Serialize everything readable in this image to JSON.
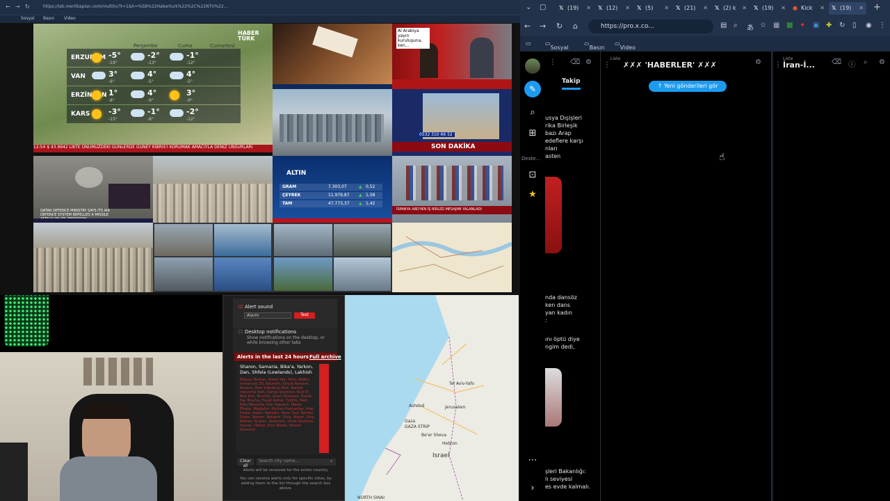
{
  "left_browser": {
    "url": "https://lab.meritkaplan.com/multitv/?t=1&h=%5B%22Haberturk%22%2C%22NTV%22...",
    "bookmarks": [
      "Sosyal",
      "Basın",
      "Video"
    ],
    "weather": {
      "brand": "HABER TÜRK",
      "days": [
        "Perşembe",
        "Cuma",
        "Cumartesi"
      ],
      "rows": [
        {
          "city": "ERZURUM",
          "t": [
            "-5°",
            "-2°",
            "-1°"
          ],
          "s": [
            "-19°",
            "-13°",
            "-12°"
          ]
        },
        {
          "city": "VAN",
          "t": [
            "3°",
            "4°",
            "4°"
          ],
          "s": [
            "-6°",
            "-5°",
            "-5°"
          ]
        },
        {
          "city": "ERZİNCAN",
          "t": [
            "1°",
            "4°",
            "3°"
          ],
          "s": [
            "-8°",
            "-9°",
            "-9°"
          ]
        },
        {
          "city": "KARS",
          "t": [
            "-3°",
            "-1°",
            "-2°"
          ],
          "s": [
            "-15°",
            "-8°",
            "-12°"
          ]
        }
      ]
    },
    "ticker": "12:54  $ 43.9942  LİKTE ÖNÜMÜZDEKİ GÜNLERDE GÜNEY KIBRIS'I KORUMAK AMACIYLA DENİZ UNSURLARI",
    "arabic_caption": "Al Arabiya yayın kuruluşuna, ken...",
    "son_dakika": "SON DAKİKA",
    "phone": "0532 310 66 52",
    "spain_caption": "İSPANYA ABD'NİN İŞ BİRLİĞİ MESAJIMI YALANLADI",
    "qatar_caption": "QATAR DEFENCE MINISTRY SAYS ITS AIR DEFENCE SYSTEM REPELLED A MISSILE ATTACK ON ITS TERRITORY",
    "gold": {
      "title": "ALTIN",
      "rows": [
        {
          "name": "GRAM",
          "value": "7.303,07",
          "change": "0,52"
        },
        {
          "name": "ÇEYREK",
          "value": "11.979,87",
          "change": "1,58"
        },
        {
          "name": "TAM",
          "value": "47.773,37",
          "change": "1,42"
        }
      ]
    },
    "alerts": {
      "alert_sound_label": "Alert sound",
      "alarm_option": "Alarm",
      "test_label": "Test",
      "desktop_notif_label": "Desktop notifications",
      "desktop_notif_desc": "Show notifications on the desktop, or while browsing other tabs",
      "last24_label": "Alerts in the last 24 hours",
      "archive_label": "Full archive",
      "region_title": "Sharon, Samaria, Bika'a, Yarkon, Dan, Shfela (Lowlands), Lakhish",
      "city_list": "Elkana, Barkan, Hamit Yair, Yehu, Nofim, Immanuel, Eli, Kdumim, Einyet Revalim, Revava, Ariel Industrial Park, Barkan Industrial Park, Karnei Shomron, Burt El, Beit Arie, Bruchin, Ginot Shomron, Oranit, Har Bracha, Havat Avihai, Tzofim, Yakir, Alfei Menashe, Kfar Tapuach, Maale Efraim, Migdalim, Kochav Hashachar, Ariel Hadar, Adam, Rehelim, Neve Tzuf, Nahliel, Dolev, Talmon, Netafim, Shilo, Ateret, Ofra, Kokhav Ya'akov, Kedumim, Ginot Shomron, Itamar, Yitzhar, Elon Moreh, Shavei Shomron",
      "clear_all": "Clear all",
      "search_placeholder": "Search city name...",
      "footer1": "Alerts will be received for the entire country.",
      "footer2": "You can receive alerts only for specific cities, by adding them to the list through the search box above."
    },
    "map_labels": [
      "Tel Aviv-Yafo",
      "Ashdod",
      "Jerusalem",
      "GAZA STRIP",
      "Gaza",
      "Hebron",
      "Be'er Sheva",
      "Israel",
      "NORTH SINAI"
    ]
  },
  "right_browser": {
    "tabs": [
      {
        "label": "(19)"
      },
      {
        "label": "(12)"
      },
      {
        "label": "(5)"
      },
      {
        "label": "(21)"
      },
      {
        "label": "(2) k"
      },
      {
        "label": "(19)"
      },
      {
        "label": "Kick"
      },
      {
        "label": "(19)"
      }
    ],
    "url": "https://pro.x.co...",
    "bookmarks": [
      "Sosyal",
      "Basın",
      "Video"
    ],
    "sidebar_label": "Deste...",
    "col1": {
      "header": "Takip",
      "post1": "usya Dışişleri\nrika Birleşik\nbazı Arap\nedeflere karşı\nnları\nasten",
      "post2": "nda dansöz\nken dans\nyan kadın\n:",
      "post3": "ını öptü diye\nngim dedi,",
      "post4": "şleri Bakanlığı:\nlı seviyesi\nes evde kalmalı."
    },
    "col2": {
      "label": "Liste",
      "title": "✗✗✗ 'HABERLER' ✗✗✗",
      "new_posts": "Yeni gönderileri gör"
    },
    "col3": {
      "label": "Liste",
      "title": "İran-İ..."
    }
  }
}
